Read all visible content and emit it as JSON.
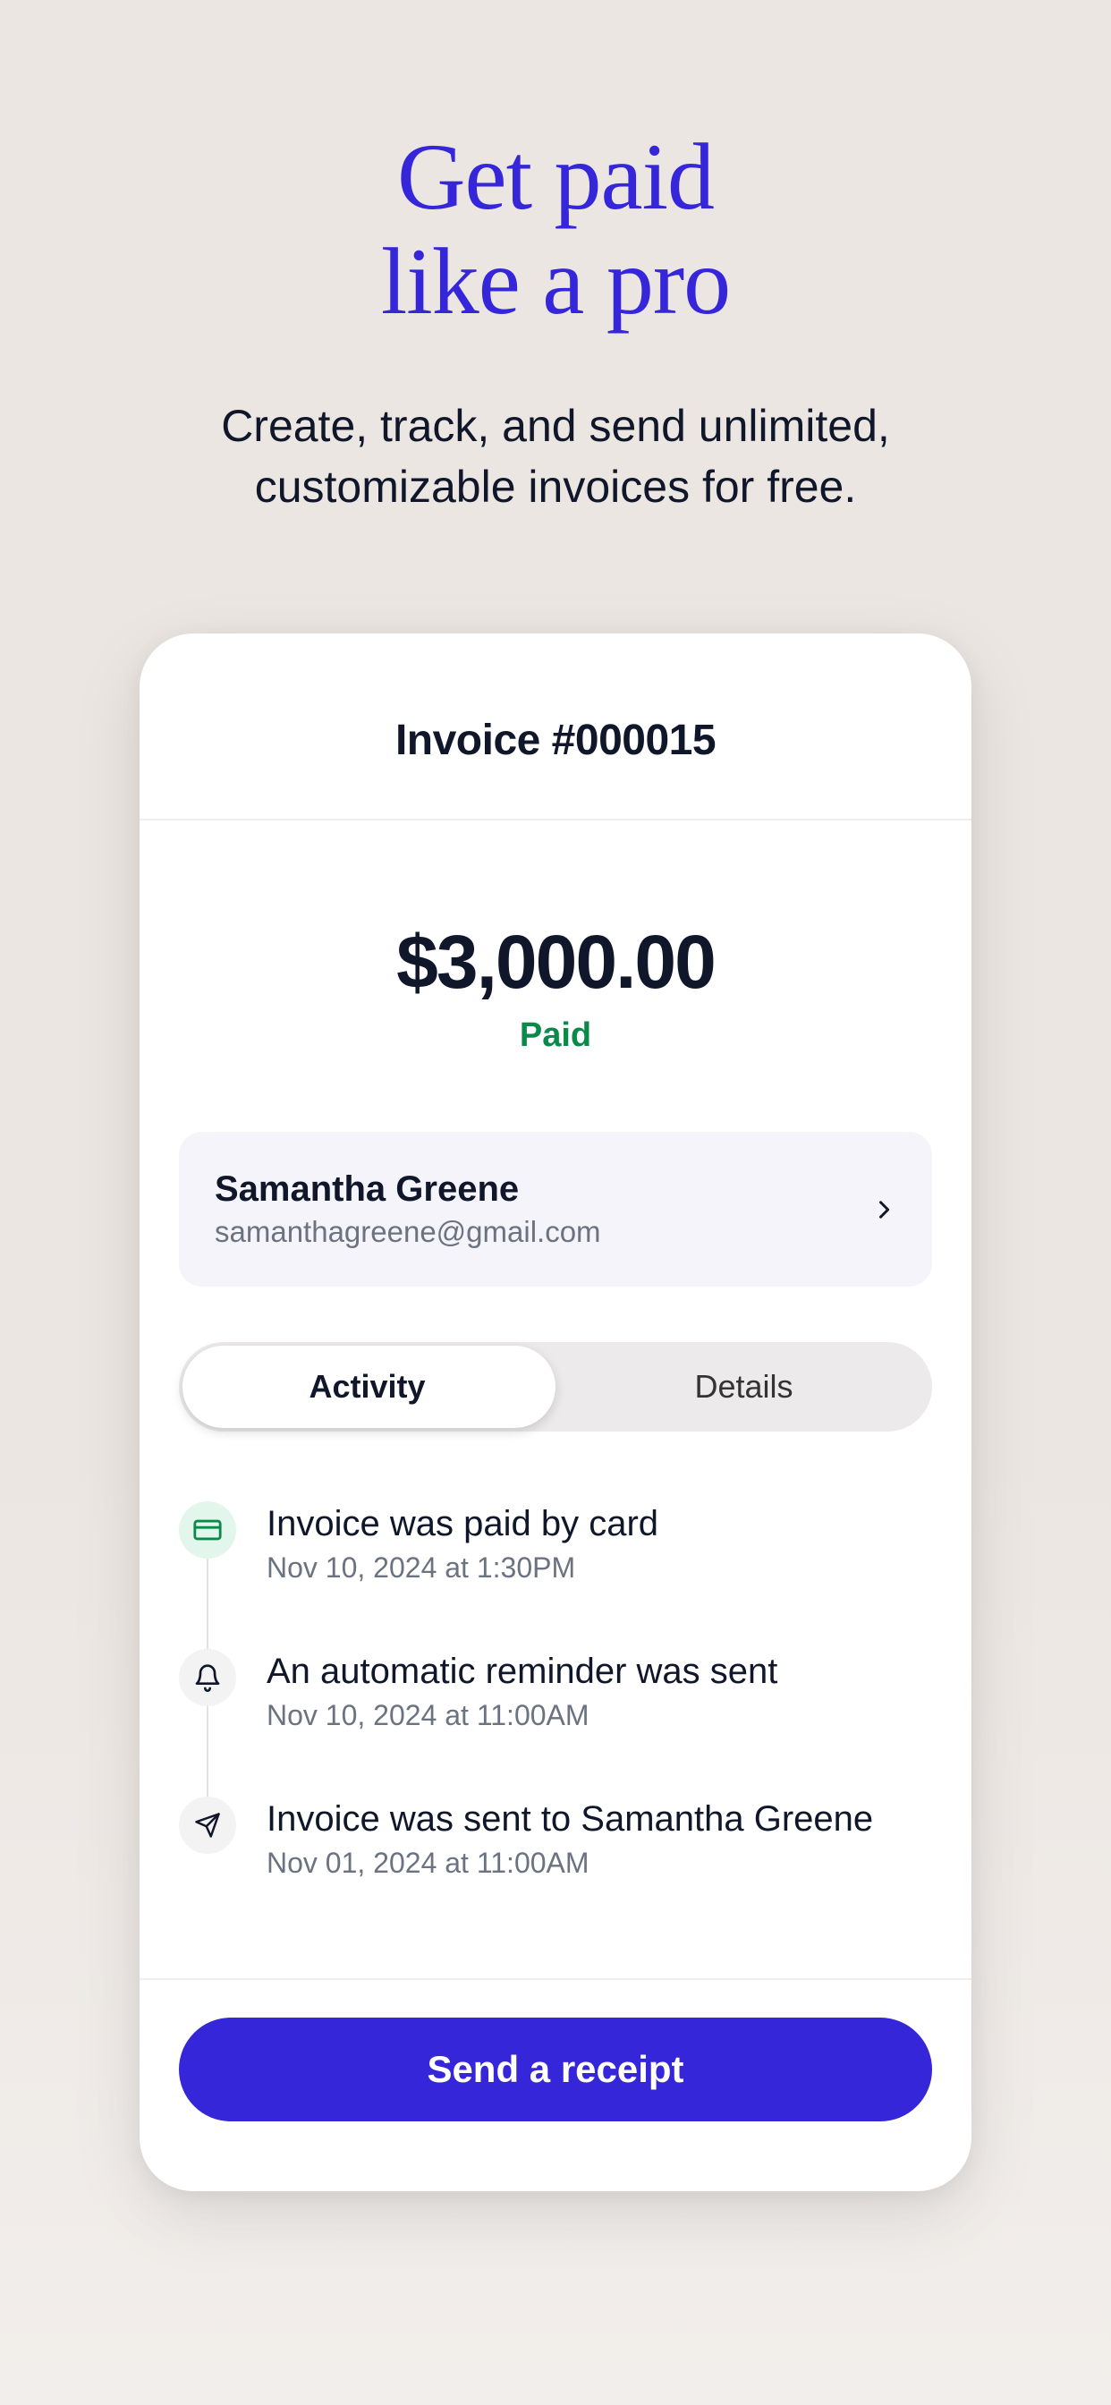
{
  "hero": {
    "title_line1": "Get paid",
    "title_line2": "like a pro",
    "subtitle": "Create, track, and send unlimited, customizable invoices for free."
  },
  "invoice": {
    "header_title": "Invoice #000015",
    "amount": "$3,000.00",
    "status": "Paid",
    "payer": {
      "name": "Samantha Greene",
      "email": "samanthagreene@gmail.com"
    },
    "tabs": {
      "activity": "Activity",
      "details": "Details"
    },
    "activity": [
      {
        "icon": "card",
        "title": "Invoice was paid by card",
        "time": "Nov 10, 2024 at 1:30PM"
      },
      {
        "icon": "bell",
        "title": "An automatic reminder was sent",
        "time": "Nov 10, 2024 at 11:00AM"
      },
      {
        "icon": "send",
        "title": "Invoice was sent to Samantha Greene",
        "time": "Nov 01, 2024 at 11:00AM"
      }
    ],
    "cta": "Send a receipt"
  },
  "colors": {
    "accent": "#3626d9",
    "success": "#0a8a4a"
  }
}
